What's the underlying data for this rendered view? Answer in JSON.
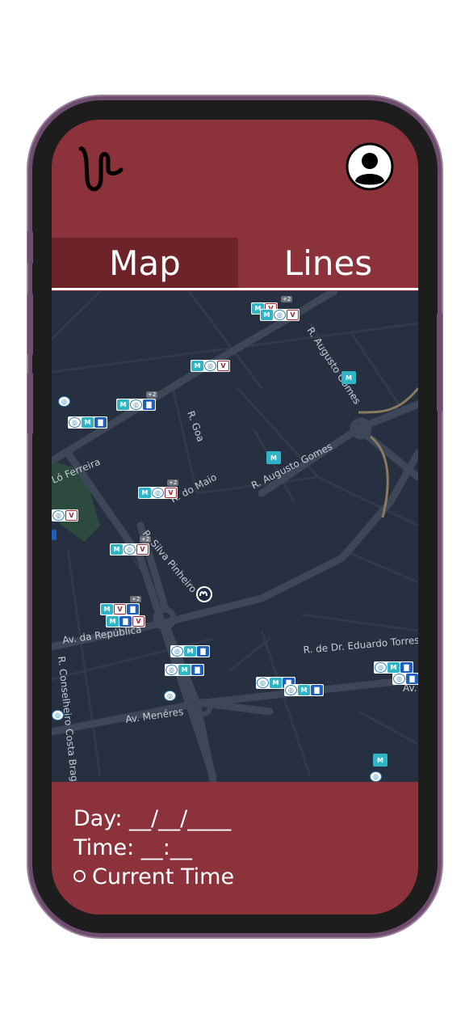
{
  "tabs": [
    {
      "label": "Map",
      "active": true
    },
    {
      "label": "Lines",
      "active": false
    }
  ],
  "map": {
    "streets": [
      "R. Augusto Gomes",
      "R. Goa",
      "Ló Ferreira",
      "R. Augusto Gomes",
      "R. do Maio",
      "R. Silva Pinheiro",
      "Av. da República",
      "R. de Dr. Eduardo Torres",
      "R. Conselheiro Costa Braga",
      "Av. Menéres",
      "Av."
    ],
    "badge": "+2"
  },
  "bottom": {
    "day": "Day: __/__/____",
    "time": "Time: __:__",
    "current_time": "Current Time"
  },
  "colors": {
    "brand": "#8b323a",
    "tab_active": "#6e2329",
    "map_bg": "#263040",
    "road": "#3d4757"
  },
  "icons": [
    "logo-icon",
    "user-avatar-icon",
    "metro-icon",
    "bus-icon",
    "train-icon",
    "walk-icon",
    "stop-pin-icon"
  ]
}
